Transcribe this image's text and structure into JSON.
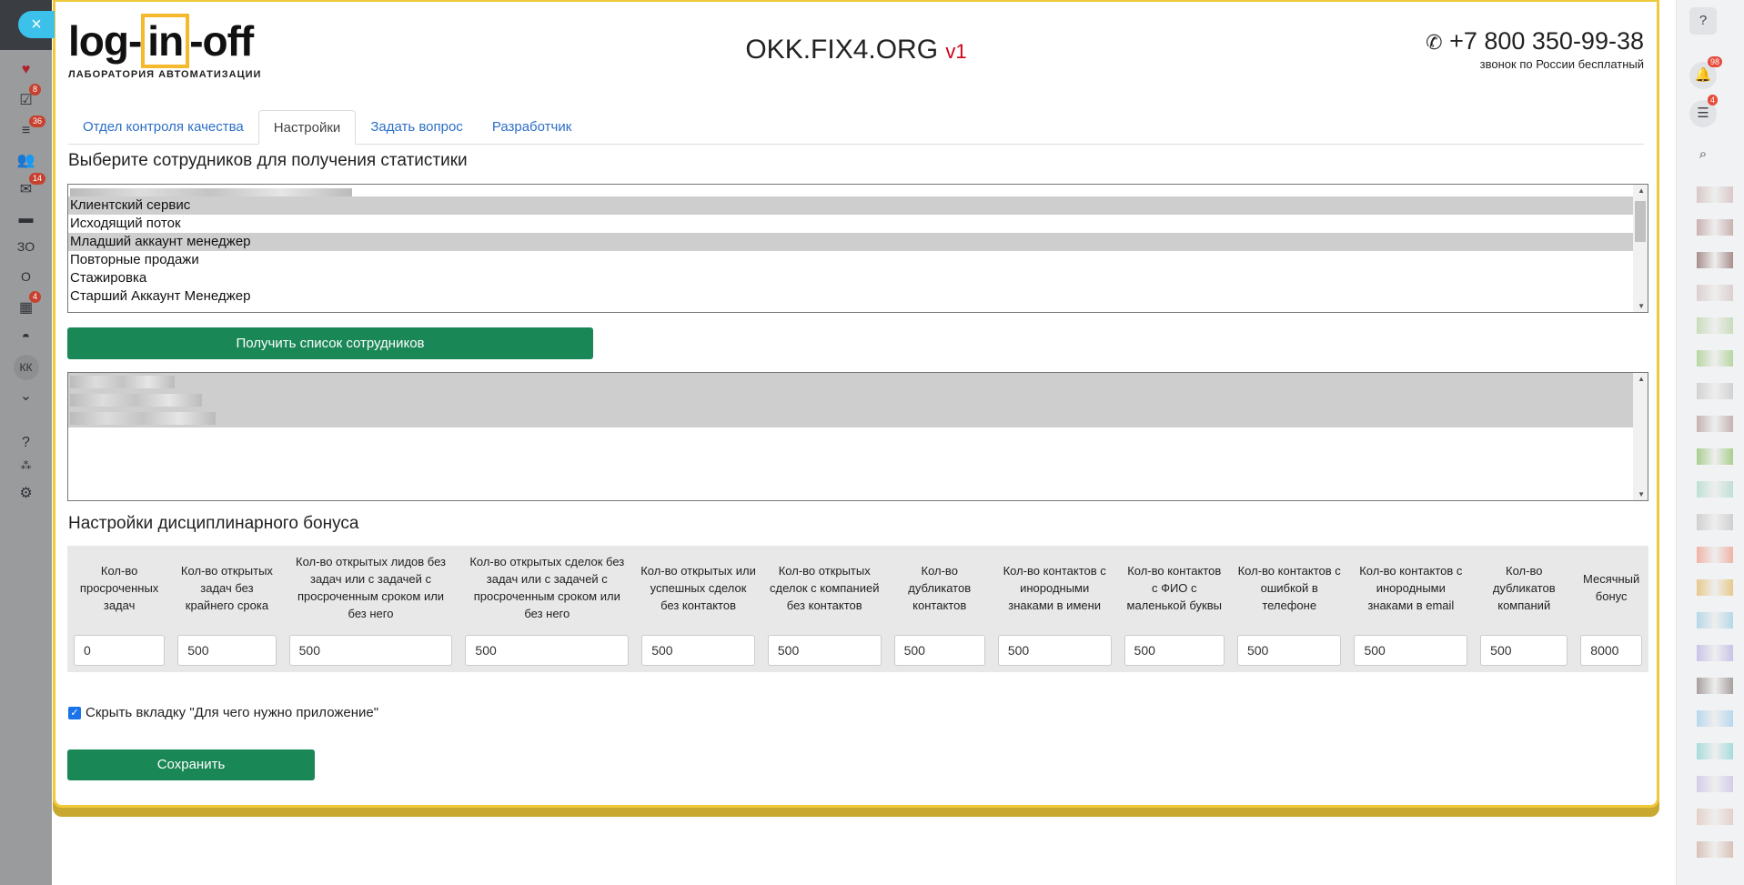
{
  "left_sidebar": {
    "close": "×",
    "badges": {
      "tasks": "8",
      "filter": "36",
      "mail": "14",
      "calendar": "4"
    },
    "text_items": [
      "ЗО",
      "О"
    ],
    "avatar": "КК"
  },
  "header": {
    "logo_word_1": "log-",
    "logo_word_in": "in",
    "logo_word_2": "-off",
    "logo_sub": "ЛАБОРАТОРИЯ АВТОМАТИЗАЦИИ",
    "title": "OKK.FIX4.ORG",
    "version": "v1",
    "phone": "+7 800 350-99-38",
    "phone_note": "звонок по России бесплатный"
  },
  "tabs": [
    "Отдел контроля качества",
    "Настройки",
    "Задать вопрос",
    "Разработчик"
  ],
  "employees_section": {
    "heading": "Выберите сотрудников для получения статистики",
    "departments": [
      {
        "label": "Клиентский сервис",
        "selected": true
      },
      {
        "label": "Исходящий поток",
        "selected": false
      },
      {
        "label": "Младший аккаунт менеджер",
        "selected": true
      },
      {
        "label": "Повторные продажи",
        "selected": false
      },
      {
        "label": "Стажировка",
        "selected": false
      },
      {
        "label": "Старший Аккаунт Менеджер",
        "selected": false
      }
    ],
    "get_button": "Получить список сотрудников"
  },
  "bonus_section": {
    "heading": "Настройки дисциплинарного бонуса",
    "columns": [
      {
        "label": "Кол-во просроченных задач",
        "value": "0"
      },
      {
        "label": "Кол-во открытых задач без крайнего срока",
        "value": "500"
      },
      {
        "label": "Кол-во открытых лидов без задач или с задачей с просроченным сроком или без него",
        "value": "500"
      },
      {
        "label": "Кол-во открытых сделок без задач или с задачей с просроченным сроком или без него",
        "value": "500"
      },
      {
        "label": "Кол-во открытых или успешных сделок без контактов",
        "value": "500"
      },
      {
        "label": "Кол-во открытых сделок с компанией без контактов",
        "value": "500"
      },
      {
        "label": "Кол-во дубликатов контактов",
        "value": "500"
      },
      {
        "label": "Кол-во контактов с инородными знаками в имени",
        "value": "500"
      },
      {
        "label": "Кол-во контактов с ФИО с маленькой буквы",
        "value": "500"
      },
      {
        "label": "Кол-во контактов с ошибкой в телефоне",
        "value": "500"
      },
      {
        "label": "Кол-во контактов с инородными знаками в email",
        "value": "500"
      },
      {
        "label": "Кол-во дубликатов компаний",
        "value": "500"
      },
      {
        "label": "Месячный бонус",
        "value": "8000"
      }
    ]
  },
  "hide_tab_checkbox": {
    "label": "Скрыть вкладку \"Для чего нужно приложение\"",
    "checked": true
  },
  "save_button": "Сохранить",
  "right_sidebar": {
    "notifications_badge": "98",
    "chat_badge": "4"
  },
  "colors": {
    "accent_green": "#1a8756",
    "modal_border": "#f0c93a",
    "link": "#2d6fc7"
  }
}
